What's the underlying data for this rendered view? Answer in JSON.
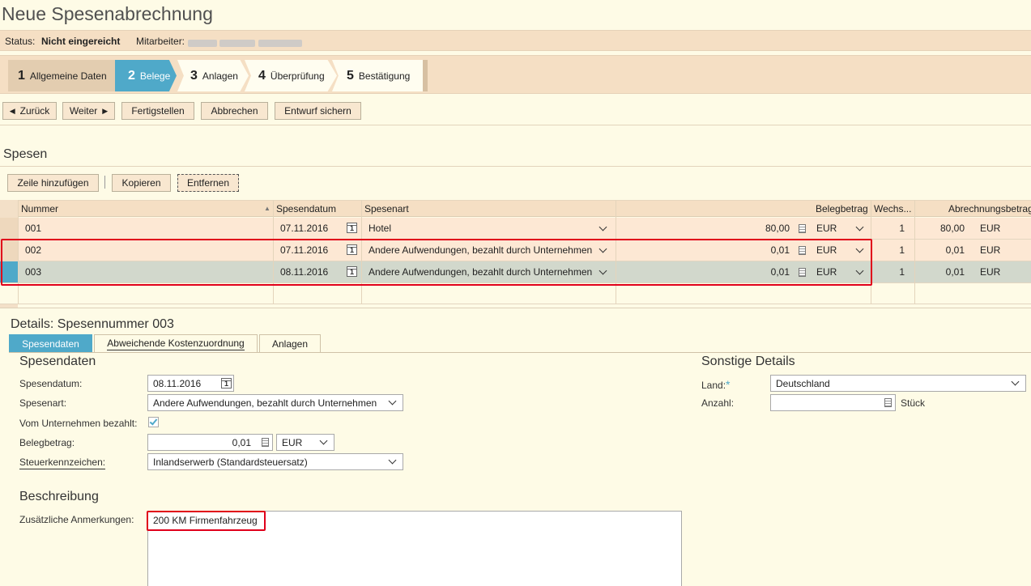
{
  "title": "Neue Spesenabrechnung",
  "status": {
    "label": "Status:",
    "value": "Nicht eingereicht",
    "employee_label": "Mitarbeiter:"
  },
  "steps": [
    {
      "num": "1",
      "label": "Allgemeine Daten"
    },
    {
      "num": "2",
      "label": "Belege"
    },
    {
      "num": "3",
      "label": "Anlagen"
    },
    {
      "num": "4",
      "label": "Überprüfung"
    },
    {
      "num": "5",
      "label": "Bestätigung"
    }
  ],
  "toolbar": {
    "back": "Zurück",
    "next": "Weiter",
    "finish": "Fertigstellen",
    "cancel": "Abbrechen",
    "save_draft": "Entwurf sichern"
  },
  "expenses": {
    "title": "Spesen",
    "add_row": "Zeile hinzufügen",
    "copy": "Kopieren",
    "remove": "Entfernen",
    "columns": {
      "number": "Nummer",
      "date": "Spesendatum",
      "type": "Spesenart",
      "amount": "Belegbetrag",
      "rate": "Wechs...",
      "settlement": "Abrechnungsbetrag"
    },
    "rows": [
      {
        "number": "001",
        "date": "07.11.2016",
        "type": "Hotel",
        "amount": "80,00",
        "currency": "EUR",
        "rate": "1",
        "settlement": "80,00",
        "settlement_currency": "EUR"
      },
      {
        "number": "002",
        "date": "07.11.2016",
        "type": "Andere Aufwendungen, bezahlt durch Unternehmen",
        "amount": "0,01",
        "currency": "EUR",
        "rate": "1",
        "settlement": "0,01",
        "settlement_currency": "EUR"
      },
      {
        "number": "003",
        "date": "08.11.2016",
        "type": "Andere Aufwendungen, bezahlt durch Unternehmen",
        "amount": "0,01",
        "currency": "EUR",
        "rate": "1",
        "settlement": "0,01",
        "settlement_currency": "EUR"
      }
    ]
  },
  "details": {
    "title": "Details: Spesennummer 003",
    "tabs": [
      "Spesendaten",
      "Abweichende Kostenzuordnung",
      "Anlagen"
    ],
    "section_title": "Spesendaten",
    "date_label": "Spesendatum:",
    "date_value": "08.11.2016",
    "type_label": "Spesenart:",
    "type_value": "Andere Aufwendungen, bezahlt durch Unternehmen",
    "paid_label": "Vom Unternehmen bezahlt:",
    "amount_label": "Belegbetrag:",
    "amount_value": "0,01",
    "currency_value": "EUR",
    "tax_label": "Steuerkennzeichen:",
    "tax_value": "Inlandserwerb (Standardsteuersatz)",
    "other_title": "Sonstige Details",
    "country_label": "Land:",
    "country_required": "*",
    "country_value": "Deutschland",
    "count_label": "Anzahl:",
    "count_unit": "Stück",
    "desc_title": "Beschreibung",
    "notes_label": "Zusätzliche Anmerkungen:",
    "notes_value": "200 KM Firmenfahrzeug"
  },
  "colors": {
    "active_step": "#4fa9c9",
    "highlight": "#e0001a",
    "background": "#fefbe6",
    "bar": "#f5dfc4"
  }
}
